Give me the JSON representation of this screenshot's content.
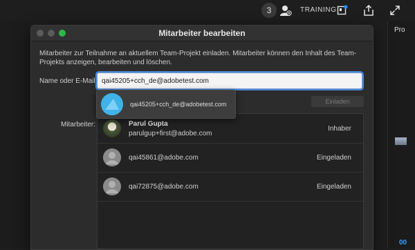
{
  "topbar": {
    "notification_count": "3",
    "training_label": "TRAINING"
  },
  "right_panel": {
    "pro_label": "Pro",
    "time_label": "00"
  },
  "dialog": {
    "title": "Mitarbeiter bearbeiten",
    "description": "Mitarbeiter zur Teilnahme an aktuellem Team-Projekt einladen. Mitarbeiter können den Inhalt des Team-Projekts anzeigen, bearbeiten und löschen.",
    "field_label": "Name oder E-Mail:",
    "input_value": "qai45205+cch_de@adobetest.com",
    "invite_label": "Einladen",
    "members_label": "Mitarbeiter:",
    "members": [
      {
        "name": "Parul Gupta",
        "email": "parulgup+first@adobe.com",
        "role": "Inhaber",
        "avatar": "photo"
      },
      {
        "name": "",
        "email": "qai45861@adobe.com",
        "role": "Eingeladen",
        "avatar": "default-user-icon"
      },
      {
        "name": "",
        "email": "qai72875@adobe.com",
        "role": "Eingeladen",
        "avatar": "default-user-icon"
      }
    ],
    "suggestion": {
      "email": "qai45205+cch_de@adobetest.com",
      "avatar": "triangle-avatar-icon"
    }
  },
  "colors": {
    "accent": "#4b86d6",
    "window_zoom": "#2fb74b",
    "suggestion_avatar": "#3fb3e8"
  }
}
